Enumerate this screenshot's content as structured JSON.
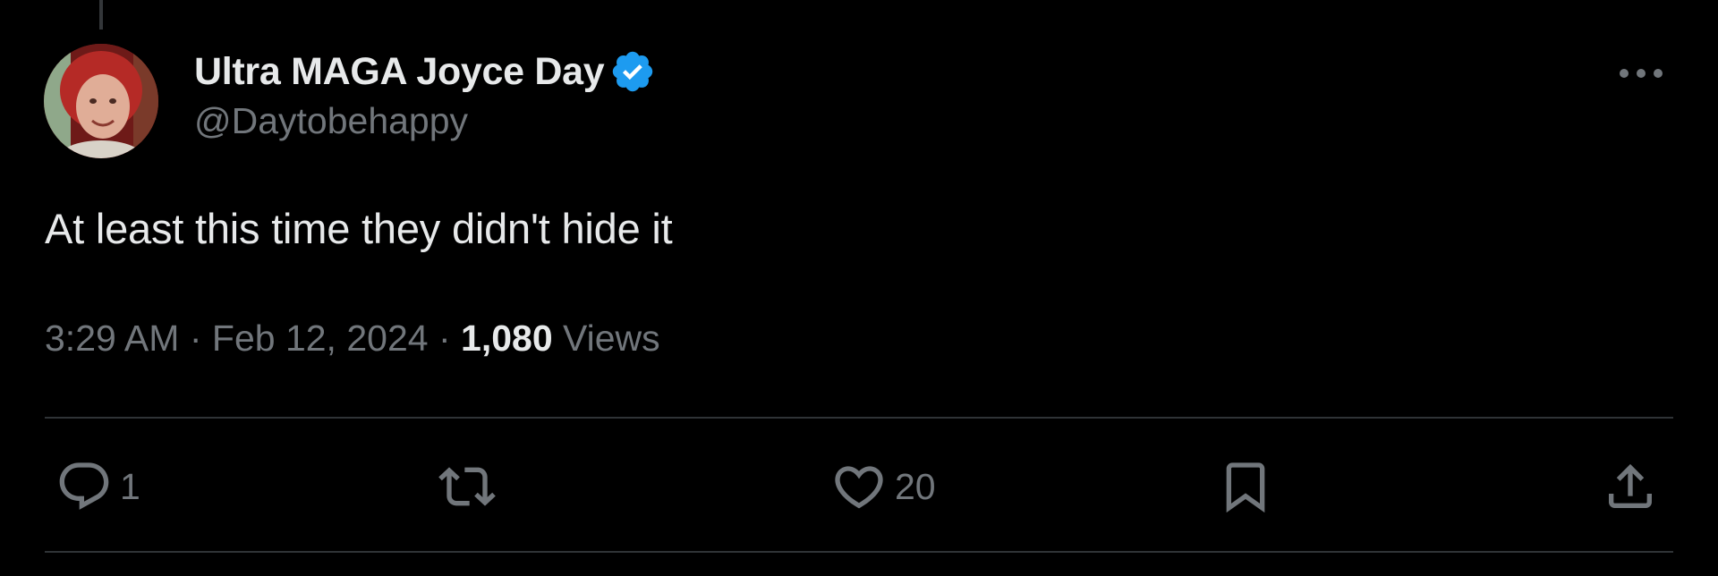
{
  "author": {
    "display_name": "Ultra MAGA Joyce Day",
    "handle": "@Daytobehappy",
    "verified": true,
    "verified_color": "#1d9bf0"
  },
  "tweet": {
    "text": "At least this time they didn't hide it"
  },
  "meta": {
    "time": "3:29 AM",
    "separator": "·",
    "date": "Feb 12, 2024",
    "views_count": "1,080",
    "views_label": "Views"
  },
  "actions": {
    "reply_count": "1",
    "retweet_count": "",
    "like_count": "20",
    "icons": [
      "reply-icon",
      "retweet-icon",
      "like-icon",
      "bookmark-icon",
      "share-icon"
    ]
  },
  "colors": {
    "background": "#000000",
    "primary_text": "#e7e9ea",
    "secondary_text": "#71767b",
    "divider": "#2f3336"
  }
}
